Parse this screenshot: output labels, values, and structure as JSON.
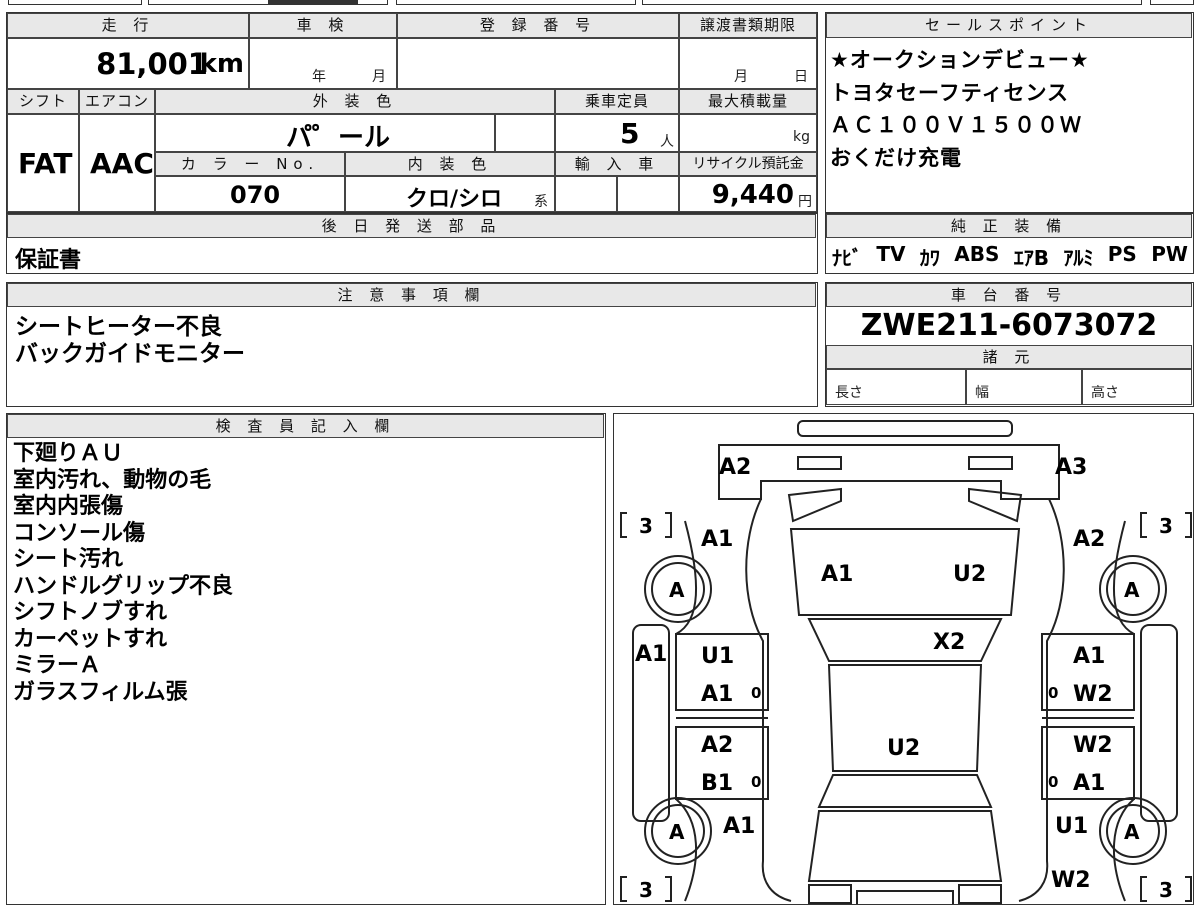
{
  "vehicle": {
    "mileage_label": "走 行",
    "mileage": "81,001",
    "mileage_unit": "km",
    "inspection_label": "車 検",
    "inspection_year": "年",
    "inspection_month": "月",
    "registration_label": "登 録 番 号",
    "transfer_label": "譲渡書類期限",
    "transfer_month": "月",
    "transfer_day": "日",
    "shift_label": "シフト",
    "shift": "FAT",
    "ac_label": "エアコン",
    "ac": "AAC",
    "exterior_label": "外 装 色",
    "exterior": "パ゜ール",
    "color_no_label": "カ ラ ー No.",
    "color_no": "070",
    "interior_label": "内 装 色",
    "interior": "クロ/シロ",
    "interior_suffix": "系",
    "capacity_label": "乗車定員",
    "capacity": "5",
    "capacity_unit": "人",
    "max_load_label": "最大積載量",
    "max_load_unit": "kg",
    "import_label": "輸 入 車",
    "recycle_label": "リサイクル預託金",
    "recycle": "9,440",
    "recycle_unit": "円"
  },
  "sales_points": {
    "label": "セールスポイント",
    "lines": [
      "★オークションデビュー★",
      "トヨタセーフティセンス",
      "ＡＣ１００Ｖ１５００Ｗ",
      "おくだけ充電"
    ]
  },
  "later_parts": {
    "label": "後 日 発 送 部 品",
    "value": "保証書"
  },
  "equipment": {
    "label": "純 正 装 備",
    "items": [
      "ﾅﾋﾞ",
      "TV",
      "ｶﾜ",
      "ABS",
      "ｴｱB",
      "ｱﾙﾐ",
      "PS",
      "PW"
    ]
  },
  "notes": {
    "label": "注 意 事 項 欄",
    "lines": [
      "シートヒーター不良",
      "バックガイドモニター"
    ]
  },
  "chassis": {
    "label": "車 台 番 号",
    "value": "ZWE211-6073072",
    "specs_label": "諸 元",
    "length_label": "長さ",
    "width_label": "幅",
    "height_label": "高さ"
  },
  "inspector": {
    "label": "検 査 員 記 入 欄",
    "lines": [
      "下廻りＡＵ",
      "室内汚れ、動物の毛",
      "室内内張傷",
      "コンソール傷",
      "シート汚れ",
      "ハンドルグリップ不良",
      "シフトノブすれ",
      "カーペットすれ",
      "ミラーＡ",
      "ガラスフィルム張"
    ]
  },
  "diagram": {
    "marks": {
      "front_left": "A2",
      "front_right": "A3",
      "fender_fl": "A1",
      "fender_fr": "A2",
      "hood_left": "A1",
      "hood_right": "U2",
      "windshield": "X2",
      "sill_left": "A1",
      "door_fl_top": "U1",
      "door_fl_bottom": "A1",
      "door_rl_top": "A2",
      "door_rl_bottom": "B1",
      "door_fr_top": "A1",
      "door_fr_bottom": "W2",
      "door_rr_top": "W2",
      "door_rr_bottom": "A1",
      "roof": "U2",
      "rear_fender_left": "A1",
      "rear_fender_right": "U1",
      "rear_right_low": "W2",
      "tyre": "A",
      "tread": "3",
      "zero": "0"
    }
  }
}
